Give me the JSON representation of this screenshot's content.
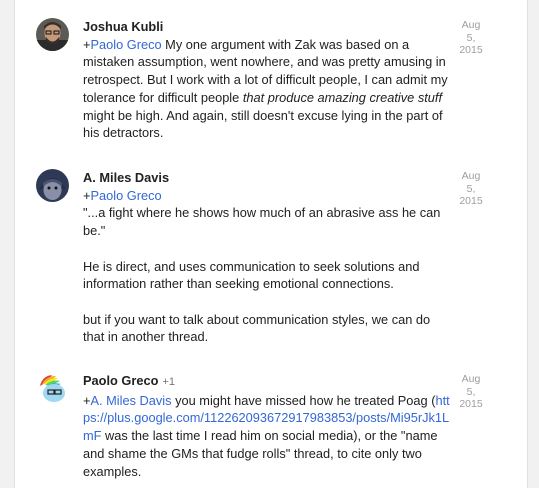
{
  "comments": [
    {
      "author": "Joshua Kubli",
      "plus_ones": "",
      "date": [
        "Aug",
        "5,",
        "2015"
      ],
      "mention": "Paolo Greco",
      "text_1": " My one argument with Zak was based on a mistaken assumption, went nowhere, and was pretty amusing in retrospect. But I work with a lot of difficult people, I can admit my tolerance for difficult people ",
      "text_em": "that produce amazing creative stuff",
      "text_2": " might be high. And again, still doesn't excuse lying in the part of his detractors."
    },
    {
      "author": "A. Miles Davis",
      "plus_ones": "",
      "date": [
        "Aug",
        "5,",
        "2015"
      ],
      "mention": "Paolo Greco",
      "paragraphs": [
        "\"...a fight where he shows how much of an abrasive ass he can be.\"",
        "He is direct, and uses communication to seek solutions and information rather than seeking emotional connections.",
        "but if you want to talk about communication styles, we can do that in another thread."
      ]
    },
    {
      "author": "Paolo Greco",
      "plus_ones": "+1",
      "date": [
        "Aug",
        "5,",
        "2015"
      ],
      "mention": "A. Miles Davis",
      "text_1": " you might have missed how he treated Poag (",
      "url": "https://plus.google.com/112262093672917983853/posts/Mi95rJk1LmF",
      "text_2": " was the last time I read him on social media), or the \"name and shame the GMs that fudge rolls\" thread, to cite only two examples."
    }
  ],
  "plus_sign": "+",
  "colors": {
    "link": "#3367d6",
    "date": "#9e9e9e",
    "text": "#212121",
    "background": "#f1f1f1"
  }
}
